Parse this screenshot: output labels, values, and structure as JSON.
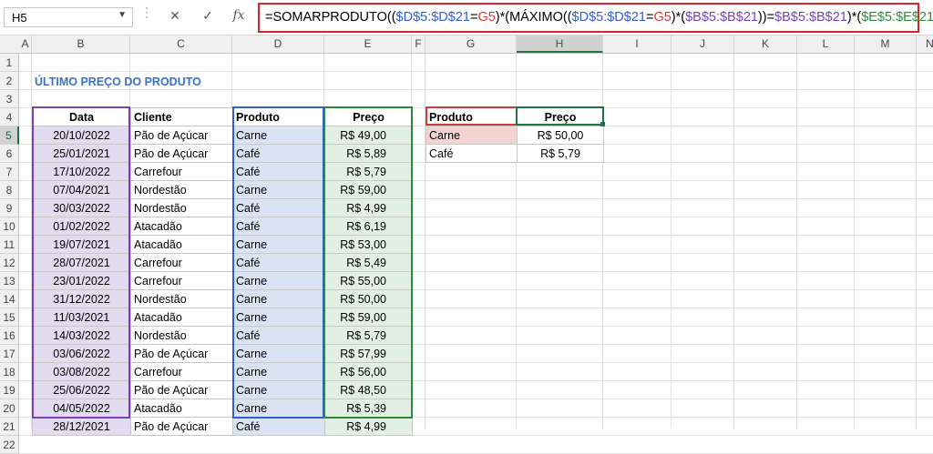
{
  "formula_bar": {
    "name_box": "H5",
    "cancel_icon": "✕",
    "enter_icon": "✓",
    "fx_label": "fx",
    "formula_parts": [
      {
        "t": "=SOMARPRODUTO((",
        "c": ""
      },
      {
        "t": "$D$5:$D$21",
        "c": "c-blue"
      },
      {
        "t": "=",
        "c": ""
      },
      {
        "t": "G5",
        "c": "c-red"
      },
      {
        "t": ")*(MÁXIMO((",
        "c": ""
      },
      {
        "t": "$D$5:$D$21",
        "c": "c-blue"
      },
      {
        "t": "=",
        "c": ""
      },
      {
        "t": "G5",
        "c": "c-red"
      },
      {
        "t": ")*(",
        "c": ""
      },
      {
        "t": "$B$5:$B$21",
        "c": "c-purple"
      },
      {
        "t": "))=",
        "c": ""
      },
      {
        "t": "$B$5:$B$21",
        "c": "c-purple"
      },
      {
        "t": ")*(",
        "c": ""
      },
      {
        "t": "$E$5:$E$21",
        "c": "c-green"
      },
      {
        "t": "))",
        "c": ""
      }
    ]
  },
  "columns": [
    "A",
    "B",
    "C",
    "D",
    "E",
    "F",
    "G",
    "H",
    "I",
    "J",
    "K",
    "L",
    "M",
    "N"
  ],
  "selected_column": "H",
  "rows": [
    "1",
    "2",
    "3",
    "4",
    "5",
    "6",
    "7",
    "8",
    "9",
    "10",
    "11",
    "12",
    "13",
    "14",
    "15",
    "16",
    "17",
    "18",
    "19",
    "20",
    "21",
    "22"
  ],
  "selected_row": "5",
  "title": "ÚLTIMO PREÇO DO PRODUTO",
  "table": {
    "headers": [
      "Data",
      "Cliente",
      "Produto",
      "Preço"
    ],
    "rows": [
      [
        "20/10/2022",
        "Pão de Açúcar",
        "Carne",
        "R$ 49,00"
      ],
      [
        "25/01/2021",
        "Pão de Açúcar",
        "Café",
        "R$ 5,89"
      ],
      [
        "17/10/2022",
        "Carrefour",
        "Café",
        "R$ 5,79"
      ],
      [
        "07/04/2021",
        "Nordestão",
        "Carne",
        "R$ 59,00"
      ],
      [
        "30/03/2022",
        "Nordestão",
        "Café",
        "R$ 4,99"
      ],
      [
        "01/02/2022",
        "Atacadão",
        "Café",
        "R$ 6,19"
      ],
      [
        "19/07/2021",
        "Atacadão",
        "Carne",
        "R$ 53,00"
      ],
      [
        "28/07/2021",
        "Carrefour",
        "Café",
        "R$ 5,49"
      ],
      [
        "23/01/2022",
        "Carrefour",
        "Carne",
        "R$ 55,00"
      ],
      [
        "31/12/2022",
        "Nordestão",
        "Carne",
        "R$ 50,00"
      ],
      [
        "11/03/2021",
        "Atacadão",
        "Carne",
        "R$ 59,00"
      ],
      [
        "14/03/2022",
        "Nordestão",
        "Café",
        "R$ 5,79"
      ],
      [
        "03/06/2022",
        "Pão de Açúcar",
        "Carne",
        "R$ 57,99"
      ],
      [
        "03/08/2022",
        "Carrefour",
        "Carne",
        "R$ 56,00"
      ],
      [
        "25/06/2022",
        "Pão de Açúcar",
        "Carne",
        "R$ 48,50"
      ],
      [
        "04/05/2022",
        "Atacadão",
        "Carne",
        "R$ 5,39"
      ],
      [
        "28/12/2021",
        "Pão de Açúcar",
        "Café",
        "R$ 4,99"
      ]
    ]
  },
  "lookup": {
    "headers": [
      "Produto",
      "Preço"
    ],
    "rows": [
      [
        "Carne",
        "R$ 50,00"
      ],
      [
        "Café",
        "R$ 5,79"
      ]
    ]
  },
  "colors": {
    "formula_border": "#d9232b",
    "date_range": "#7b3fb8",
    "product_range": "#2f5fd1",
    "price_range": "#2a8a3a",
    "criteria": "#d13a3a",
    "selection": "#217346"
  }
}
